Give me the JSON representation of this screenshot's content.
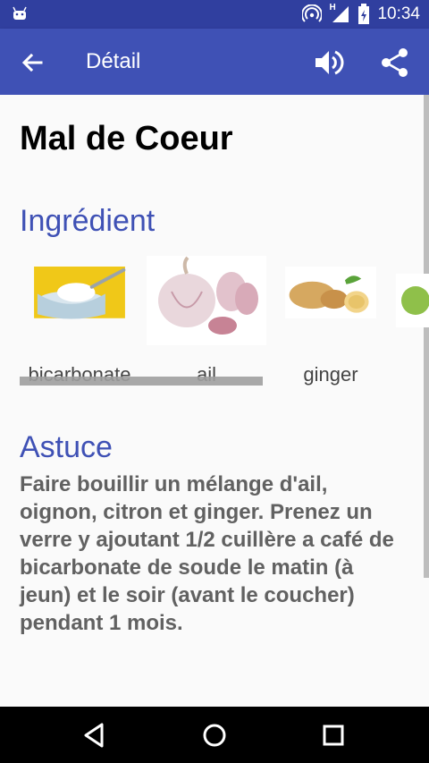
{
  "status_bar": {
    "time": "10:34",
    "network_label": "H",
    "icons": [
      "android-icon",
      "hotspot-icon",
      "signal-icon",
      "battery-icon"
    ]
  },
  "app_bar": {
    "title": "Détail",
    "back_icon": "arrow-back-icon",
    "actions": [
      "speaker-icon",
      "share-icon"
    ],
    "color": "#3f51b5",
    "status_color": "#303f9f"
  },
  "detail": {
    "heading": "Mal de Coeur",
    "ingredients_title": "Ingrédient",
    "ingredients": [
      {
        "label": "bicarbonate"
      },
      {
        "label": "ail"
      },
      {
        "label": "ginger"
      }
    ],
    "tip_title": "Astuce",
    "tip_text": "Faire bouillir un mélange d'ail, oignon, citron et ginger. Prenez un verre y ajoutant 1/2 cuillère a café de bicarbonate de soude le matin (à jeun) et le soir (avant le coucher) pendant 1 mois."
  },
  "nav_bar": {
    "buttons": [
      "back-triangle-icon",
      "home-circle-icon",
      "recents-square-icon"
    ]
  }
}
